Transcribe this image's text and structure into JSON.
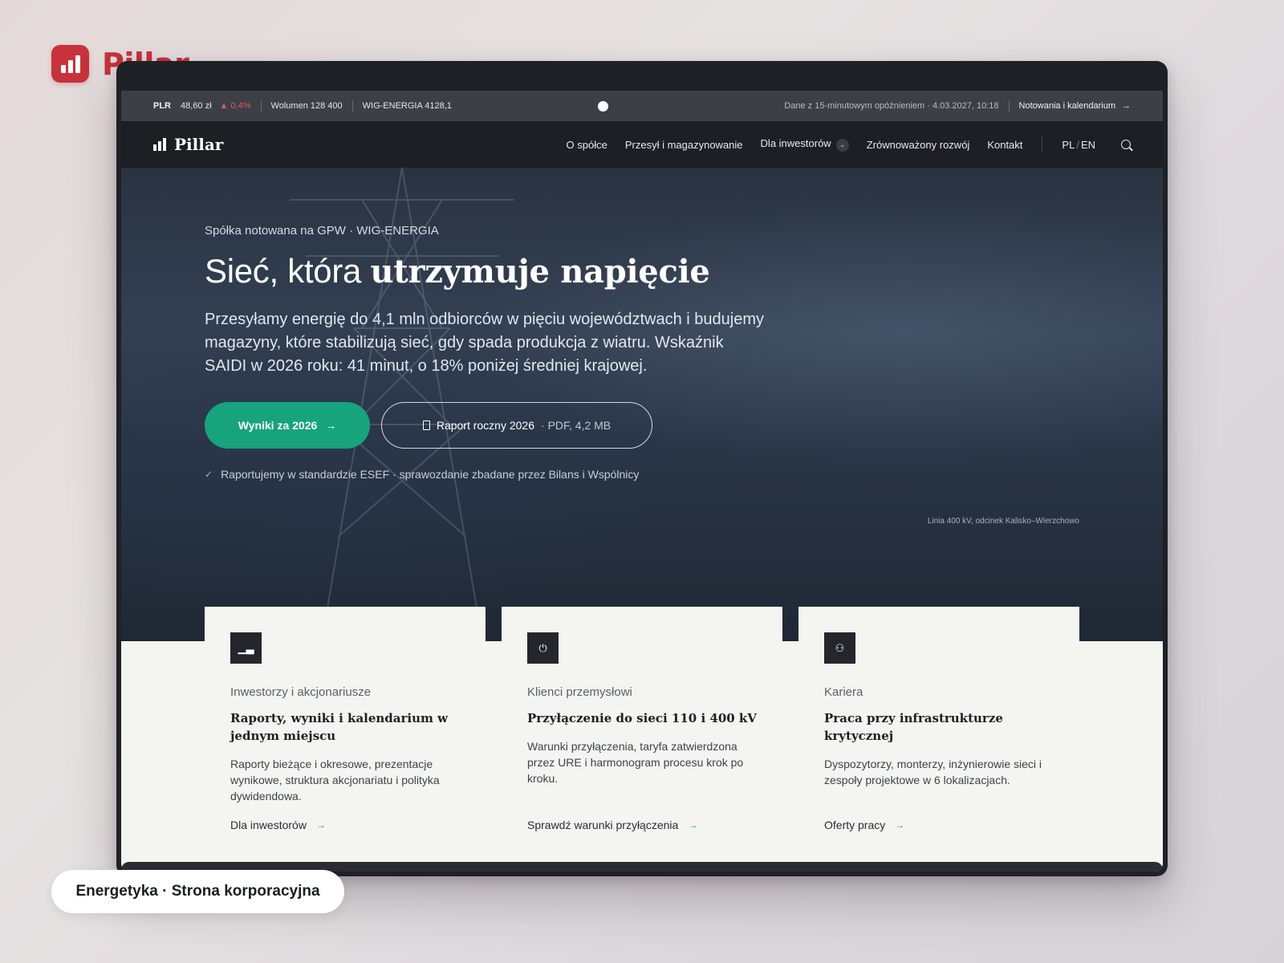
{
  "brand": {
    "name": "Pillar",
    "color": "#c8323a"
  },
  "ticker": {
    "symbol": "PLR",
    "price": "48,60 zł",
    "change": "▲ 0,4%",
    "volume": "Wolumen 128 400",
    "index": "WIG-ENERGIA 4128,1",
    "delay_note": "Dane z 15-minutowym opóźnieniem · 4.03.2027, 10:18",
    "link": "Notowania i kalendarium",
    "link_arrow": "→"
  },
  "nav": {
    "logo": "Pillar",
    "items": [
      {
        "label": "O spółce"
      },
      {
        "label": "Przesył i magazynowanie"
      },
      {
        "label": "Dla inwestorów"
      },
      {
        "label": "Zrównoważony rozwój"
      },
      {
        "label": "Kontakt"
      }
    ],
    "dropdown_glyph": "⌄",
    "lang_pl": "PL",
    "lang_sep": "/",
    "lang_en": "EN",
    "search_icon": "search-icon"
  },
  "hero": {
    "eyebrow": "Spółka notowana na GPW · WIG-ENERGIA",
    "headline_plain": "Sieć, która ",
    "headline_serif": "utrzymuje napięcie",
    "lead": "Przesyłamy energię do 4,1 mln odbiorców w pięciu województwach i budujemy magazyny, które stabilizują sieć, gdy spada produkcja z wiatru. Wskaźnik SAIDI w 2026 roku: 41 minut, o 18% poniżej średniej krajowej.",
    "primary_cta": "Wyniki za 2026",
    "primary_arrow": "→",
    "secondary_cta": "Raport roczny 2026",
    "secondary_meta": "· PDF, 4,2 MB",
    "note_check": "✓",
    "note": "Raportujemy w standardzie ESEF · sprawozdanie zbadane przez Bilans i Wspólnicy",
    "caption": "Linia 400 kV, odcinek Kalisko–Wierzchowo",
    "accent": "#17a37c"
  },
  "cards": [
    {
      "icon": "bar-chart-icon",
      "glyph": "▁▃",
      "label": "Inwestorzy i akcjonariusze",
      "title": "Raporty, wyniki i kalendarium w jednym miejscu",
      "desc": "Raporty bieżące i okresowe, prezentacje wynikowe, struktura akcjonariatu i polityka dywidendowa.",
      "link": "Dla inwestorów",
      "arrow": "→"
    },
    {
      "icon": "plug-icon",
      "glyph": "⏻",
      "label": "Klienci przemysłowi",
      "title": "Przyłączenie do sieci 110 i 400 kV",
      "desc": "Warunki przyłączenia, taryfa zatwierdzona przez URE i harmonogram procesu krok po kroku.",
      "link": "Sprawdź warunki przyłączenia",
      "arrow": "→"
    },
    {
      "icon": "people-icon",
      "glyph": "⚇",
      "label": "Kariera",
      "title": "Praca przy infrastrukturze krytycznej",
      "desc": "Dyspozytorzy, monterzy, inżynierowie sieci i zespoły projektowe w 6 lokalizacjach.",
      "link": "Oferty pracy",
      "arrow": "→"
    }
  ],
  "pill": {
    "label": "Energetyka · Strona korporacyjna"
  }
}
